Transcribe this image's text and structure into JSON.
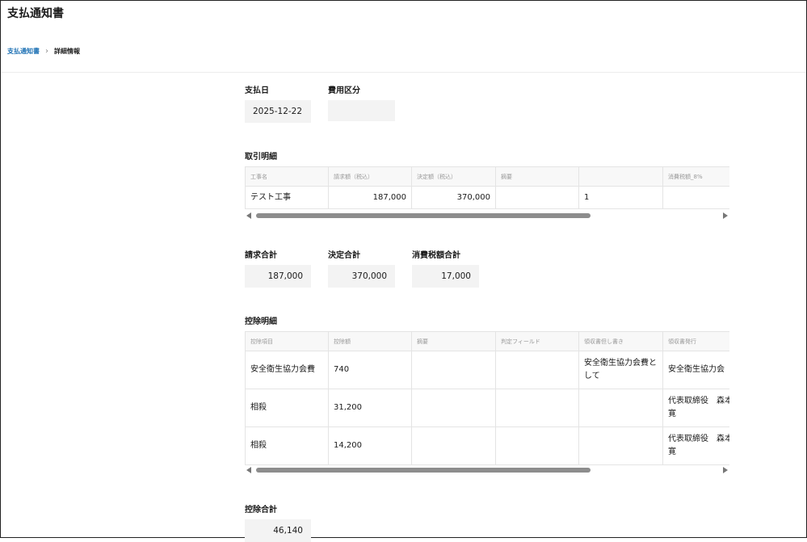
{
  "app": {
    "title": "支払通知書"
  },
  "breadcrumb": {
    "parent": "支払通知書",
    "current": "詳細情報"
  },
  "payment": {
    "date_label": "支払日",
    "date_value": "2025-12-22",
    "category_label": "費用区分",
    "category_value": ""
  },
  "transactions": {
    "title": "取引明細",
    "columns": [
      "工事名",
      "請求額（税込）",
      "決定額（税込）",
      "摘要",
      "",
      "消費税額_8%"
    ],
    "rows": [
      [
        "テスト工事",
        "187,000",
        "370,000",
        "",
        "1",
        ""
      ]
    ]
  },
  "totals": {
    "billed_label": "請求合計",
    "billed_value": "187,000",
    "decided_label": "決定合計",
    "decided_value": "370,000",
    "tax_label": "消費税額合計",
    "tax_value": "17,000"
  },
  "deductions": {
    "title": "控除明細",
    "columns": [
      "控除項目",
      "控除額",
      "摘要",
      "判定フィールド",
      "領収書但し書き",
      "領収書発行"
    ],
    "rows": [
      [
        "安全衛生協力会費",
        "740",
        "",
        "",
        "安全衛生協力会費として",
        "安全衛生協力会"
      ],
      [
        "相殺",
        "31,200",
        "",
        "",
        "",
        "代表取締役　森本 寛"
      ],
      [
        "相殺",
        "14,200",
        "",
        "",
        "",
        "代表取締役　森本 寛"
      ]
    ]
  },
  "deduction_total": {
    "label": "控除合計",
    "value": "46,140"
  },
  "scrollbars": [
    {
      "name": "transactions",
      "position_fraction": 0.0,
      "visible_fraction": 0.72
    },
    {
      "name": "deductions",
      "position_fraction": 0.0,
      "visible_fraction": 0.72
    }
  ]
}
